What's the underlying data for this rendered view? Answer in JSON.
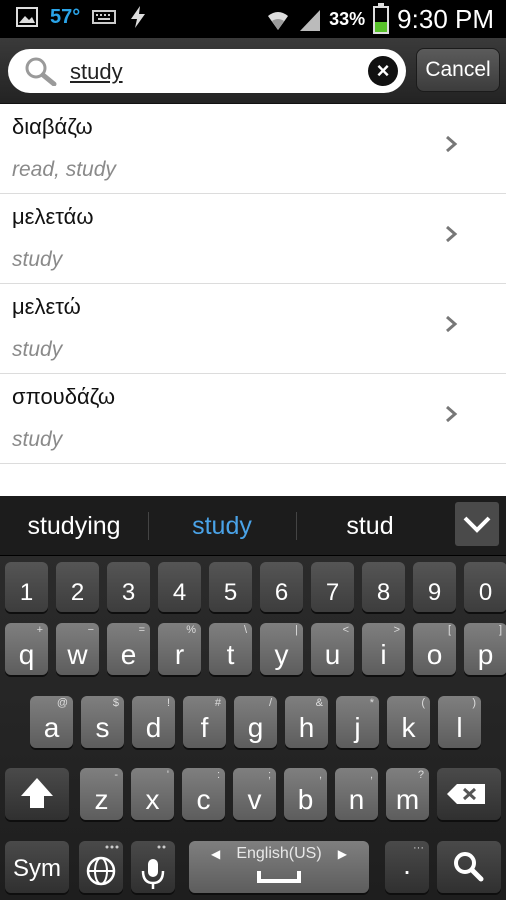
{
  "status_bar": {
    "temperature": "57°",
    "battery_percent": "33%",
    "battery_level": 0.33,
    "time": "9:30 PM",
    "icons": [
      "image-icon",
      "keyboard-icon",
      "flash-icon",
      "wifi-icon",
      "signal-icon",
      "battery-icon"
    ]
  },
  "search": {
    "value": "study",
    "clear_icon": "close-icon",
    "cancel_label": "Cancel"
  },
  "results": [
    {
      "word": "διαβάζω",
      "gloss": "read, study"
    },
    {
      "word": "μελετάω",
      "gloss": "study"
    },
    {
      "word": "μελετώ",
      "gloss": "study"
    },
    {
      "word": "σπουδάζω",
      "gloss": "study"
    }
  ],
  "keyboard": {
    "suggestions": [
      "studying",
      "study",
      "stud"
    ],
    "selected_suggestion": "study",
    "number_row": [
      "1",
      "2",
      "3",
      "4",
      "5",
      "6",
      "7",
      "8",
      "9",
      "0"
    ],
    "row1": [
      [
        "q",
        "+"
      ],
      [
        "w",
        "−"
      ],
      [
        "e",
        "="
      ],
      [
        "r",
        "%"
      ],
      [
        "t",
        "\\"
      ],
      [
        "y",
        "|"
      ],
      [
        "u",
        "<"
      ],
      [
        "i",
        ">"
      ],
      [
        "o",
        "["
      ],
      [
        "p",
        "]"
      ]
    ],
    "row2": [
      [
        "a",
        "@"
      ],
      [
        "s",
        "$"
      ],
      [
        "d",
        "!"
      ],
      [
        "f",
        "#"
      ],
      [
        "g",
        "/"
      ],
      [
        "h",
        "&"
      ],
      [
        "j",
        "*"
      ],
      [
        "k",
        "("
      ],
      [
        "l",
        ")"
      ]
    ],
    "row3": [
      [
        "z",
        "-"
      ],
      [
        "x",
        "'"
      ],
      [
        "c",
        ":"
      ],
      [
        "v",
        ";"
      ],
      [
        "b",
        ","
      ],
      [
        "n",
        ","
      ],
      [
        "m",
        "?"
      ]
    ],
    "sym_label": "Sym",
    "space_label": "English(US)",
    "period_label": ".",
    "accent_color": "#4aa3e8"
  }
}
